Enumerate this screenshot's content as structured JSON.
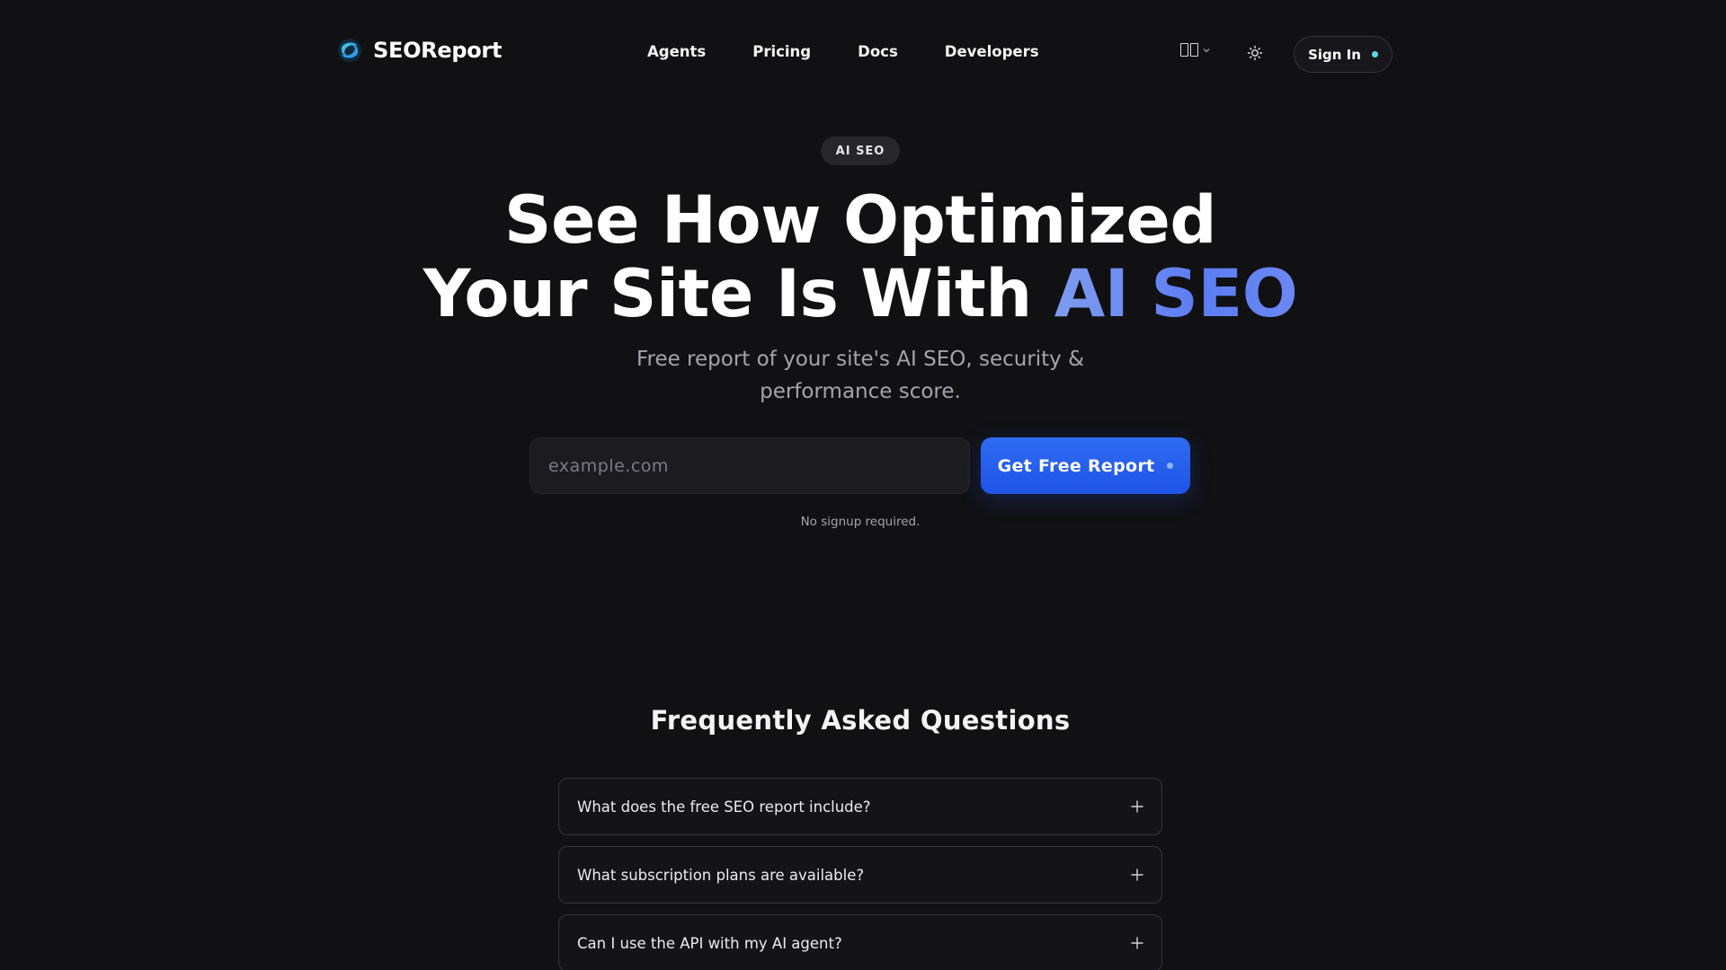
{
  "brand": {
    "name": "SEOReport",
    "logo_icon": "seoreport-swirl-logo-icon",
    "logo_colors": [
      "#3ecbd9",
      "#2a7bea"
    ]
  },
  "nav": {
    "items": [
      {
        "label": "Agents"
      },
      {
        "label": "Pricing"
      },
      {
        "label": "Docs"
      },
      {
        "label": "Developers"
      }
    ]
  },
  "header_controls": {
    "language_icon": "language-flag-icon",
    "theme_icon": "sun-icon",
    "sign_in_label": "Sign In"
  },
  "hero": {
    "badge": "AI SEO",
    "title_line1": "See How Optimized",
    "title_line2_prefix": "Your Site Is With",
    "title_line2_accent": "AI SEO",
    "subtitle": "Free report of your site's AI SEO, security & performance score.",
    "input": {
      "placeholder": "example.com",
      "value": ""
    },
    "cta_label": "Get Free Report",
    "hint": "No signup required."
  },
  "faq": {
    "title": "Frequently Asked Questions",
    "items": [
      {
        "question": "What does the free SEO report include?"
      },
      {
        "question": "What subscription plans are available?"
      },
      {
        "question": "Can I use the API with my AI agent?"
      }
    ]
  },
  "colors": {
    "background": "#111114",
    "accent": "#5d7cf2",
    "cta": "#2563eb",
    "status_dot": "#5fd6e6"
  }
}
